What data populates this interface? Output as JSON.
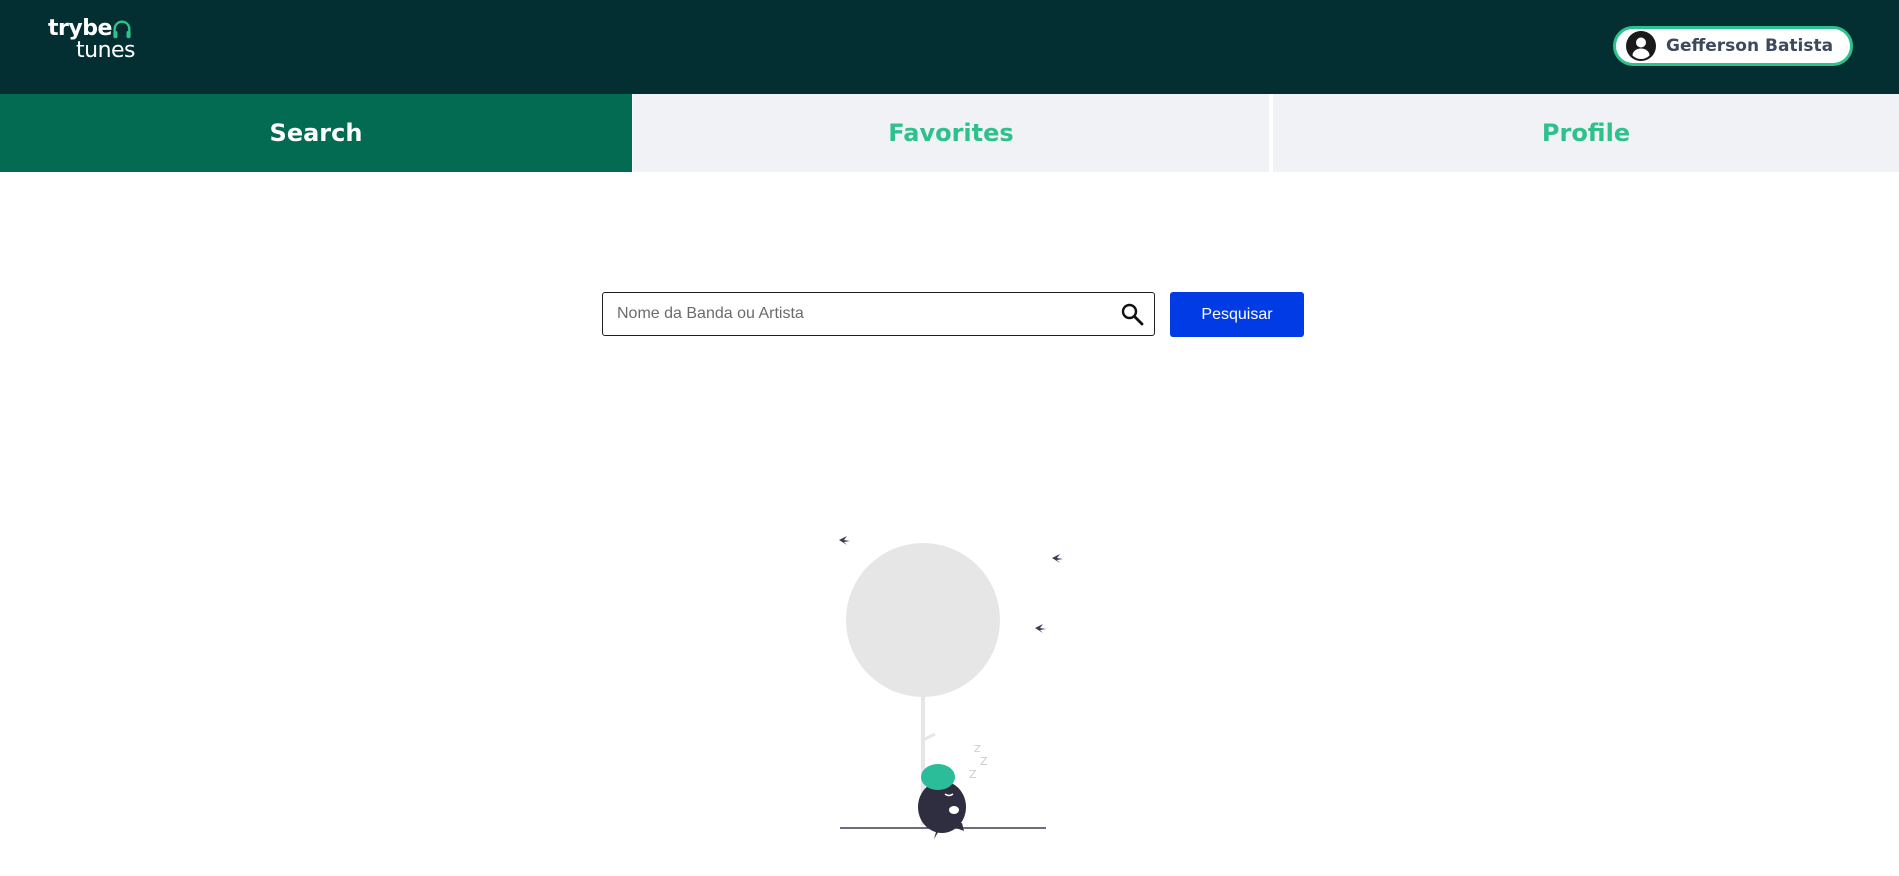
{
  "app": {
    "logo_line1": "trybe",
    "logo_line2": "tunes"
  },
  "header": {
    "user_name": "Gefferson Batista"
  },
  "tabs": [
    {
      "label": "Search",
      "active": true
    },
    {
      "label": "Favorites",
      "active": false
    },
    {
      "label": "Profile",
      "active": false
    }
  ],
  "search": {
    "placeholder": "Nome da Banda ou Artista",
    "value": "",
    "button_label": "Pesquisar"
  },
  "icons": {
    "logo": "headphones-icon",
    "user": "user-avatar-icon",
    "search": "search-icon"
  },
  "colors": {
    "header_bg": "#032f32",
    "active_tab_bg": "#036b52",
    "inactive_tab_bg": "#f0f2f5",
    "accent_green": "#2fc18c",
    "button_blue": "#003be5"
  }
}
